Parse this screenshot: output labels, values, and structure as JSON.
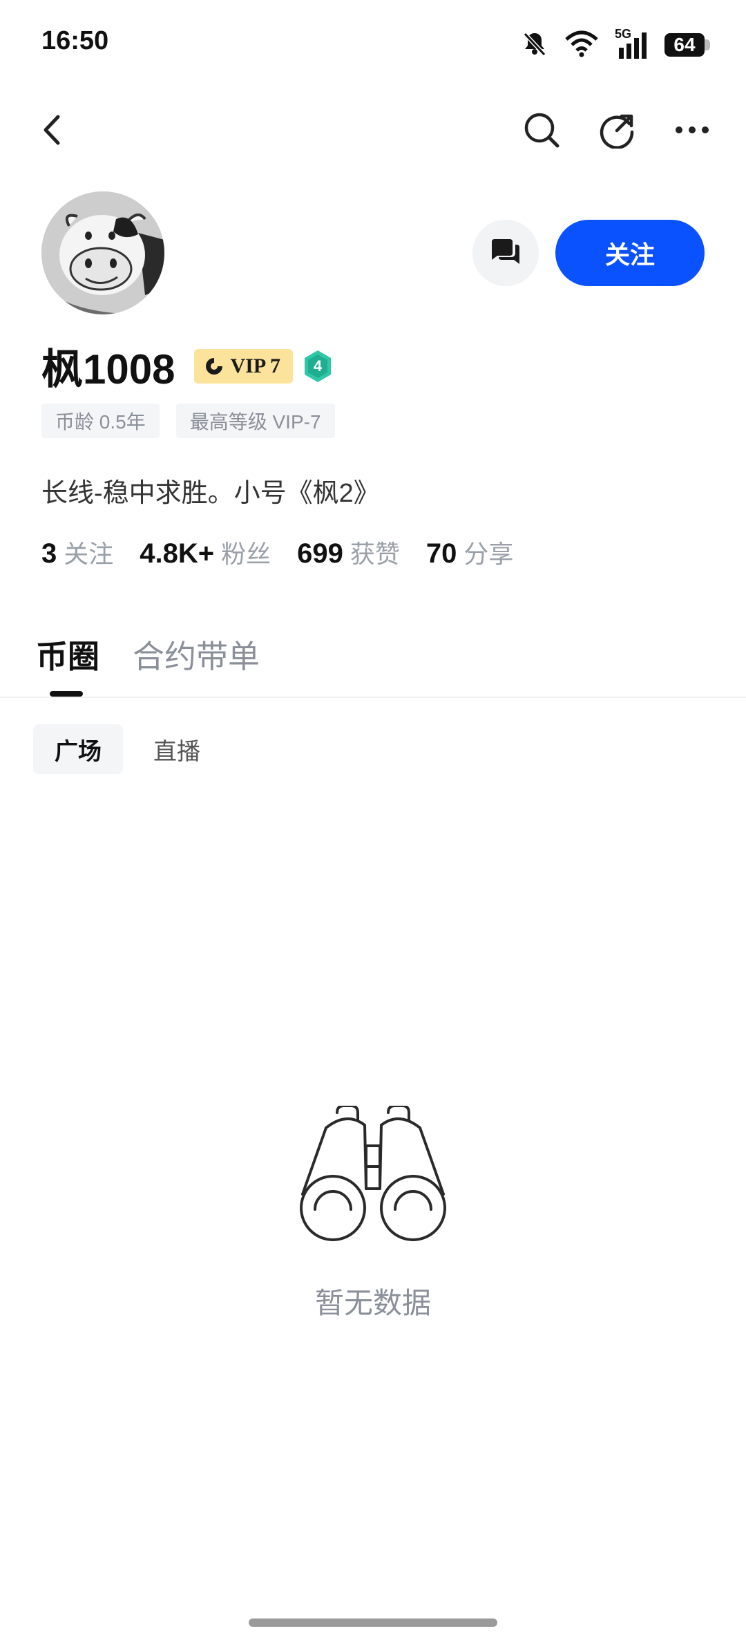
{
  "status_bar": {
    "time": "16:50",
    "signal_label": "5G",
    "battery": "64"
  },
  "nav": {
    "back_icon": "chevron-left-icon",
    "search_icon": "search-icon",
    "share_icon": "share-icon",
    "more_icon": "more-icon"
  },
  "profile": {
    "avatar_icon": "cow-avatar",
    "username": "枫1008",
    "vip_badge": "VIP 7",
    "level_badge": "4",
    "tags": [
      "币龄 0.5年",
      "最高等级 VIP-7"
    ],
    "bio": "长线-稳中求胜。小号《枫2》",
    "stats": [
      {
        "value": "3",
        "label": "关注"
      },
      {
        "value": "4.8K+",
        "label": "粉丝"
      },
      {
        "value": "699",
        "label": "获赞"
      },
      {
        "value": "70",
        "label": "分享"
      }
    ]
  },
  "actions": {
    "message_icon": "chat-icon",
    "follow_label": "关注"
  },
  "tabs": [
    {
      "label": "币圈",
      "active": true
    },
    {
      "label": "合约带单",
      "active": false
    }
  ],
  "sub_tabs": [
    {
      "label": "广场",
      "active": true
    },
    {
      "label": "直播",
      "active": false
    }
  ],
  "empty_state": {
    "icon": "binoculars-icon",
    "text": "暂无数据"
  },
  "colors": {
    "accent": "#0b52ff",
    "vip_gold": "#fbe39b",
    "level_teal": "#2fc7a6"
  }
}
